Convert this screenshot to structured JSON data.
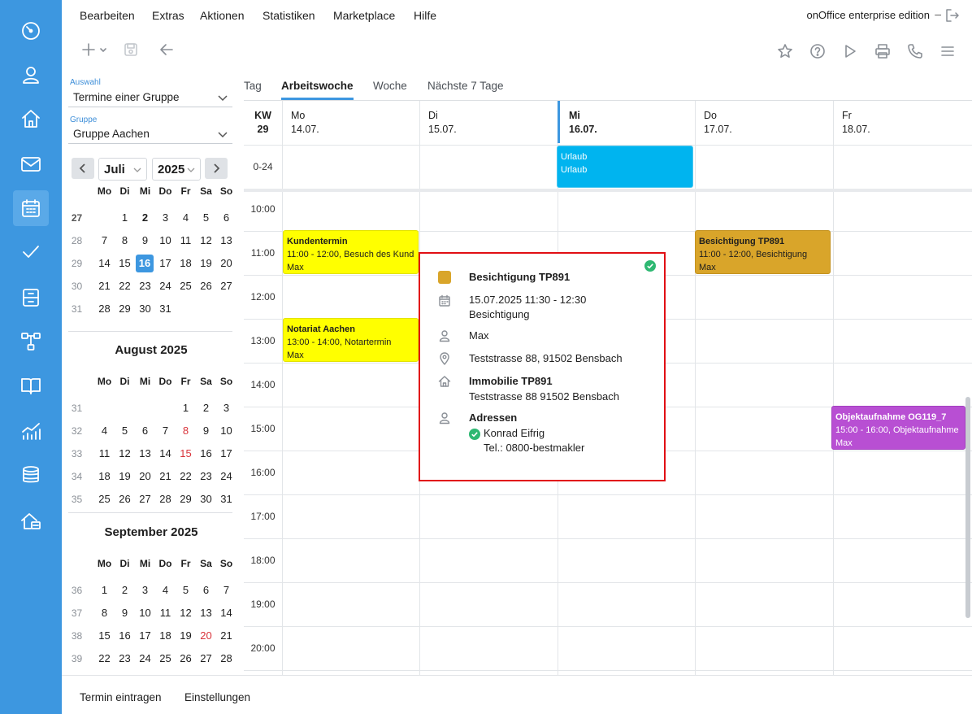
{
  "colors": {
    "nav_bg": "#3d97e0",
    "accent": "#3d97e0",
    "highlight_border": "#e10f14",
    "event_yellow": "#ffff00",
    "event_cyan": "#00b4ef",
    "event_gold": "#d9a52a",
    "event_purple": "#b84fd3",
    "status_green": "#2eb872"
  },
  "nav": {
    "icons": [
      "dashboard-icon",
      "user-icon",
      "home-icon",
      "mail-icon",
      "calendar-icon",
      "check-icon",
      "file-cabinet-icon",
      "network-icon",
      "book-icon",
      "chart-icon",
      "database-icon",
      "property-icon"
    ]
  },
  "menu": {
    "items": [
      "Bearbeiten",
      "Extras",
      "Aktionen",
      "Statistiken",
      "Marketplace",
      "Hilfe"
    ],
    "edition": "onOffice enterprise edition",
    "minimize": "–"
  },
  "sidebar": {
    "auswahl_label": "Auswahl",
    "auswahl_value": "Termine einer Gruppe",
    "gruppe_label": "Gruppe",
    "gruppe_value": "Gruppe Aachen",
    "month_select": "Juli",
    "year_select": "2025",
    "weekdays": [
      "Mo",
      "Di",
      "Mi",
      "Do",
      "Fr",
      "Sa",
      "So"
    ],
    "months": [
      {
        "title": "",
        "weeks": [
          {
            "kw": "27",
            "days": [
              "",
              "",
              "1",
              "2",
              "3",
              "4",
              "5",
              "6"
            ]
          },
          {
            "kw": "28",
            "days": [
              "7",
              "8",
              "9",
              "10",
              "11",
              "12",
              "13"
            ]
          },
          {
            "kw": "29",
            "days": [
              "14",
              "15",
              "16",
              "17",
              "18",
              "19",
              "20"
            ]
          },
          {
            "kw": "30",
            "days": [
              "21",
              "22",
              "23",
              "24",
              "25",
              "26",
              "27"
            ]
          },
          {
            "kw": "31",
            "days": [
              "28",
              "29",
              "30",
              "31",
              "",
              "",
              ""
            ]
          }
        ]
      },
      {
        "title": "August 2025",
        "weeks": [
          {
            "kw": "31",
            "days": [
              "",
              "",
              "",
              "",
              "1",
              "2",
              "3"
            ]
          },
          {
            "kw": "32",
            "days": [
              "4",
              "5",
              "6",
              "7",
              "8",
              "9",
              "10"
            ]
          },
          {
            "kw": "33",
            "days": [
              "11",
              "12",
              "13",
              "14",
              "15",
              "16",
              "17"
            ]
          },
          {
            "kw": "34",
            "days": [
              "18",
              "19",
              "20",
              "21",
              "22",
              "23",
              "24"
            ]
          },
          {
            "kw": "35",
            "days": [
              "25",
              "26",
              "27",
              "28",
              "29",
              "30",
              "31"
            ]
          }
        ]
      },
      {
        "title": "September 2025",
        "weeks": [
          {
            "kw": "36",
            "days": [
              "1",
              "2",
              "3",
              "4",
              "5",
              "6",
              "7"
            ]
          },
          {
            "kw": "37",
            "days": [
              "8",
              "9",
              "10",
              "11",
              "12",
              "13",
              "14"
            ]
          },
          {
            "kw": "38",
            "days": [
              "15",
              "16",
              "17",
              "18",
              "19",
              "20",
              "21"
            ]
          },
          {
            "kw": "39",
            "days": [
              "22",
              "23",
              "24",
              "25",
              "26",
              "27",
              "28"
            ]
          }
        ]
      }
    ]
  },
  "tabs": [
    "Tag",
    "Arbeitswoche",
    "Woche",
    "Nächste 7 Tage"
  ],
  "grid": {
    "kw_label": "KW",
    "kw_number": "29",
    "days": [
      {
        "name": "Mo",
        "date": "14.07."
      },
      {
        "name": "Di",
        "date": "15.07."
      },
      {
        "name": "Mi",
        "date": "16.07."
      },
      {
        "name": "Do",
        "date": "17.07."
      },
      {
        "name": "Fr",
        "date": "18.07."
      }
    ],
    "allday_label": "0-24",
    "times": [
      "10:00",
      "11:00",
      "12:00",
      "13:00",
      "14:00",
      "15:00",
      "16:00",
      "17:00",
      "18:00",
      "19:00",
      "20:00"
    ]
  },
  "events": {
    "urlaub": {
      "title": "Urlaub",
      "line2": "Urlaub"
    },
    "kundentermin": {
      "title": "Kundentermin",
      "line2": "11:00 - 12:00, Besuch des Kund",
      "line3": "Max"
    },
    "besichtigung": {
      "title": "Besichtigung TP891",
      "line2": "11:00 - 12:00, Besichtigung",
      "line3": "Max"
    },
    "notariat": {
      "title": "Notariat Aachen",
      "line2": "13:00 - 14:00, Notartermin",
      "line3": "Max"
    },
    "objektaufnahme": {
      "title": "Objektaufnahme OG119_7",
      "line2": "15:00 - 16:00, Objektaufnahme",
      "line3": "Max"
    }
  },
  "popup": {
    "title": "Besichtigung TP891",
    "datetime": "15.07.2025 11:30 - 12:30",
    "category": "Besichtigung",
    "user": "Max",
    "location": "Teststrasse 88, 91502 Bensbach",
    "property_title": "Immobilie TP891",
    "property_address": "Teststrasse 88 91502 Bensbach",
    "addresses_title": "Adressen",
    "contact_name": "Konrad Eifrig",
    "contact_phone": "Tel.: 0800-bestmakler"
  },
  "bottom": {
    "add_appointment": "Termin eintragen",
    "settings": "Einstellungen"
  }
}
